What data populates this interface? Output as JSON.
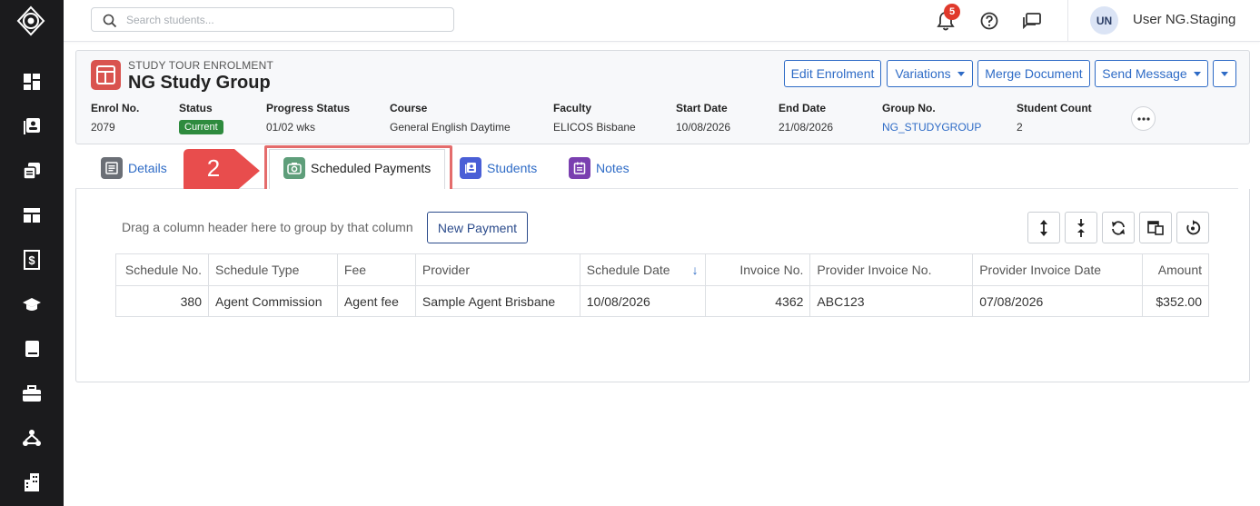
{
  "topbar": {
    "search_placeholder": "Search students...",
    "notification_count": "5",
    "user_initials": "UN",
    "user_name": "User NG.Staging"
  },
  "enrolment": {
    "type_label": "STUDY TOUR ENROLMENT",
    "title": "NG Study Group",
    "actions": {
      "edit": "Edit Enrolment",
      "variations": "Variations",
      "merge": "Merge Document",
      "send": "Send Message"
    },
    "meta": [
      {
        "label": "Enrol No.",
        "value": "2079"
      },
      {
        "label": "Status",
        "value": "Current"
      },
      {
        "label": "Progress Status",
        "value": "01/02 wks"
      },
      {
        "label": "Course",
        "value": "General English Daytime"
      },
      {
        "label": "Faculty",
        "value": "ELICOS Bisbane"
      },
      {
        "label": "Start Date",
        "value": "10/08/2026"
      },
      {
        "label": "End Date",
        "value": "21/08/2026"
      },
      {
        "label": "Group No.",
        "value": "NG_STUDYGROUP"
      },
      {
        "label": "Student Count",
        "value": "2"
      }
    ]
  },
  "tabs": [
    {
      "label": "Details"
    },
    {
      "label": "Scheduled Payments"
    },
    {
      "label": "Students"
    },
    {
      "label": "Notes"
    }
  ],
  "callout": {
    "number": "2"
  },
  "grid": {
    "group_hint": "Drag a column header here to group by that column",
    "new_payment_label": "New Payment",
    "columns": [
      "Schedule No.",
      "Schedule Type",
      "Fee",
      "Provider",
      "Schedule Date",
      "Invoice No.",
      "Provider Invoice No.",
      "Provider Invoice Date",
      "Amount"
    ],
    "rows": [
      {
        "schedule_no": "380",
        "schedule_type": "Agent Commission",
        "fee": "Agent fee",
        "provider": "Sample Agent Brisbane",
        "schedule_date": "10/08/2026",
        "invoice_no": "4362",
        "provider_invoice_no": "ABC123",
        "provider_invoice_date": "07/08/2026",
        "amount": "$352.00"
      }
    ]
  },
  "colors": {
    "sidebar_bg": "#1b1b1d",
    "link_blue": "#2e6bc6",
    "status_green": "#2e8b3e",
    "highlight_red": "#e46c6c",
    "badge_red": "#e0392b"
  }
}
